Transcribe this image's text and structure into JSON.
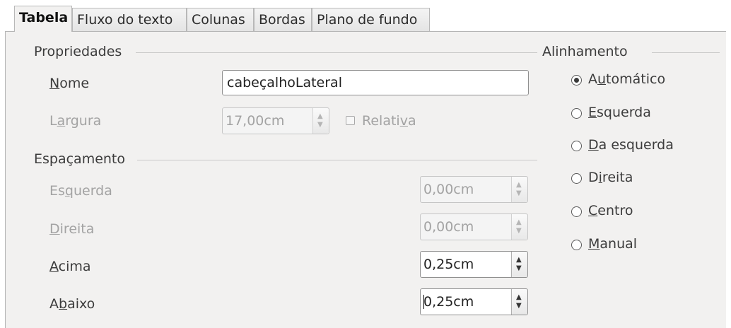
{
  "tabs": [
    {
      "label": "Tabela",
      "active": true
    },
    {
      "label": "Fluxo do texto",
      "active": false
    },
    {
      "label": "Colunas",
      "active": false
    },
    {
      "label": "Bordas",
      "active": false
    },
    {
      "label": "Plano de fundo",
      "active": false
    }
  ],
  "properties": {
    "section_title": "Propriedades",
    "name_label_u": "N",
    "name_label_rest": "ome",
    "name_value": "cabeçalhoLateral",
    "width_label_pre": "L",
    "width_label_u": "a",
    "width_label_rest": "rgura",
    "width_value": "17,00cm",
    "relative_label_pre": "Relati",
    "relative_label_u": "v",
    "relative_label_rest": "a",
    "relative_checked": false
  },
  "spacing": {
    "section_title": "Espaçamento",
    "left_label_pre": "Es",
    "left_label_u": "q",
    "left_label_rest": "uerda",
    "left_value": "0,00cm",
    "right_label_u": "D",
    "right_label_rest": "ireita",
    "right_value": "0,00cm",
    "above_label_u": "A",
    "above_label_rest": "cima",
    "above_value": "0,25cm",
    "below_label_pre": "A",
    "below_label_u": "b",
    "below_label_rest": "aixo",
    "below_value": "0,25cm"
  },
  "alignment": {
    "section_title": "Alinhamento",
    "options": [
      {
        "pre": "A",
        "u": "u",
        "rest": "tomático",
        "checked": true
      },
      {
        "pre": "",
        "u": "E",
        "rest": "squerda",
        "checked": false
      },
      {
        "pre": "",
        "u": "D",
        "rest": "a esquerda",
        "checked": false
      },
      {
        "pre": "D",
        "u": "i",
        "rest": "reita",
        "checked": false
      },
      {
        "pre": "",
        "u": "C",
        "rest": "entro",
        "checked": false
      },
      {
        "pre": "",
        "u": "M",
        "rest": "anual",
        "checked": false
      }
    ]
  },
  "icons": {
    "spin_up": "▲",
    "spin_down": "▼"
  }
}
